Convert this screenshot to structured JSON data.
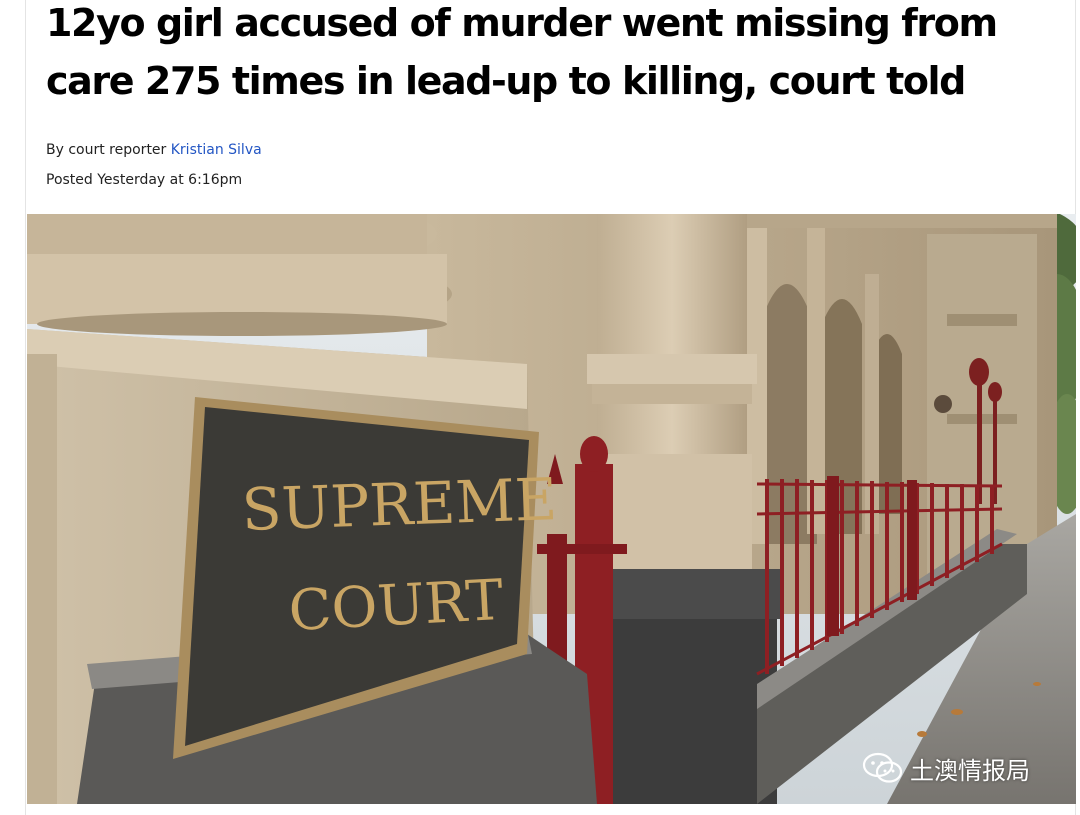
{
  "article": {
    "headline": "12yo girl accused of murder went missing from care 275 times in lead-up to killing, court told",
    "byline_prefix": "By court reporter ",
    "author": "Kristian Silva",
    "posted": "Posted Yesterday at 6:16pm"
  },
  "hero_image": {
    "sign_line1": "SUPREME",
    "sign_line2": "COURT"
  },
  "watermark": {
    "icon": "wechat-icon",
    "text": "土澳情报局"
  },
  "colors": {
    "link": "#2356c4",
    "railing": "#8e1f23",
    "sign_plate": "#3b3a36",
    "sign_letters": "#c9a564",
    "stone": "#d2c4ad"
  }
}
